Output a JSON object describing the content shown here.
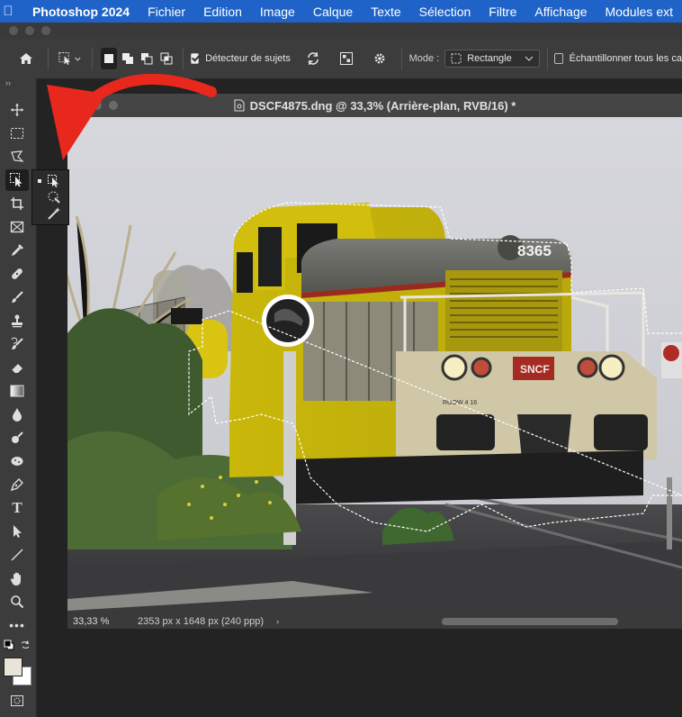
{
  "menubar": {
    "app_name": "Photoshop 2024",
    "items": [
      "Fichier",
      "Edition",
      "Image",
      "Calque",
      "Texte",
      "Sélection",
      "Filtre",
      "Affichage",
      "Modules ext"
    ]
  },
  "options_bar": {
    "subject_detector_label": "Détecteur de sujets",
    "subject_detector_checked": true,
    "mode_label": "Mode :",
    "mode_value": "Rectangle",
    "sample_all_label": "Échantillonner tous les ca",
    "sample_all_checked": false
  },
  "document": {
    "title": "DSCF4875.dng @ 33,3% (Arrière-plan, RVB/16) *",
    "zoom": "33,33 %",
    "dimensions": "2353 px x 1648 px (240 ppp)"
  },
  "photo": {
    "locomotive_number": "8365",
    "brand_plate": "SNCF",
    "small_plate": "RGOW 4 16"
  },
  "colors": {
    "menubar": "#1f63c9",
    "arrow": "#e8281d",
    "foreground": "#e9e4d8",
    "background": "#ffffff"
  },
  "tools": [
    "move-tool",
    "marquee-tool",
    "lasso-tool",
    "object-selection-tool",
    "crop-tool",
    "frame-tool",
    "eyedropper-tool",
    "healing-brush-tool",
    "brush-tool",
    "clone-stamp-tool",
    "history-brush-tool",
    "eraser-tool",
    "gradient-tool",
    "blur-tool",
    "dodge-tool",
    "sponge-tool",
    "pen-tool",
    "type-tool",
    "path-selection-tool",
    "line-tool",
    "hand-tool",
    "zoom-tool",
    "more-tools"
  ]
}
